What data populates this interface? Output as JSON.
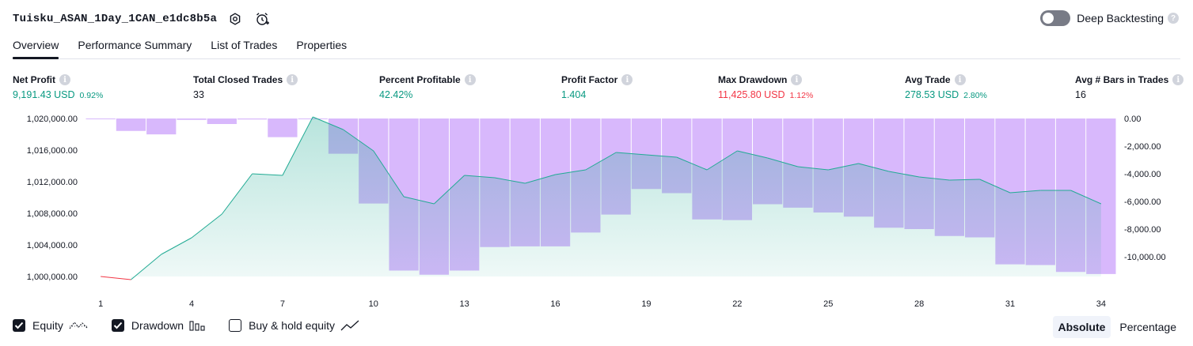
{
  "header": {
    "title": "Tuisku_ASAN_1Day_1CAN_e1dc8b5a"
  },
  "deep_backtesting": {
    "label": "Deep Backtesting"
  },
  "tabs": [
    {
      "label": "Overview"
    },
    {
      "label": "Performance Summary"
    },
    {
      "label": "List of Trades"
    },
    {
      "label": "Properties"
    }
  ],
  "stats": {
    "net_profit": {
      "label": "Net Profit",
      "value": "9,191.43 USD",
      "sub": "0.92%"
    },
    "total_closed_trades": {
      "label": "Total Closed Trades",
      "value": "33"
    },
    "percent_profitable": {
      "label": "Percent Profitable",
      "value": "42.42%"
    },
    "profit_factor": {
      "label": "Profit Factor",
      "value": "1.404"
    },
    "max_drawdown": {
      "label": "Max Drawdown",
      "value": "11,425.80 USD",
      "sub": "1.12%"
    },
    "avg_trade": {
      "label": "Avg Trade",
      "value": "278.53 USD",
      "sub": "2.80%"
    },
    "avg_bars": {
      "label": "Avg # Bars in Trades",
      "value": "16"
    }
  },
  "colors": {
    "profit": "#089981",
    "loss": "#f23645",
    "equity_line": "#22ab94",
    "drawdown_bar": "#d8b8fc"
  },
  "chart_data": {
    "type": "line",
    "x": [
      1,
      2,
      3,
      4,
      5,
      6,
      7,
      8,
      9,
      10,
      11,
      12,
      13,
      14,
      15,
      16,
      17,
      18,
      19,
      20,
      21,
      22,
      23,
      24,
      25,
      26,
      27,
      28,
      29,
      30,
      31,
      32,
      33,
      34
    ],
    "xticks": [
      "1",
      "4",
      "7",
      "10",
      "13",
      "16",
      "19",
      "22",
      "25",
      "28",
      "31",
      "34"
    ],
    "yticks_left": [
      "1,020,000.00",
      "1,016,000.00",
      "1,012,000.00",
      "1,008,000.00",
      "1,004,000.00",
      "1,000,000.00"
    ],
    "yticks_right": [
      "0.00",
      "-2,000.00",
      "-4,000.00",
      "-6,000.00",
      "-8,000.00",
      "-10,000.00"
    ],
    "ylim_left": [
      999000,
      1020000
    ],
    "ylim_right": [
      -12000,
      0
    ],
    "series": [
      {
        "name": "Equity",
        "axis": "left",
        "values": [
          1000000,
          999600,
          1002800,
          1004900,
          1007900,
          1013000,
          1012800,
          1020200,
          1018600,
          1015900,
          1010100,
          1009200,
          1012800,
          1012500,
          1011800,
          1012900,
          1013500,
          1015700,
          1015400,
          1015100,
          1013500,
          1015900,
          1015000,
          1013900,
          1013500,
          1014300,
          1013300,
          1012600,
          1012200,
          1012300,
          1010600,
          1010900,
          1010900,
          1009200
        ]
      },
      {
        "name": "Drawdown",
        "axis": "right",
        "values": [
          -50,
          -900,
          -1150,
          -100,
          -400,
          -70,
          -1350,
          0,
          -2550,
          -6150,
          -11000,
          -11300,
          -11000,
          -9300,
          -9250,
          -9250,
          -8250,
          -6950,
          -5100,
          -5400,
          -7300,
          -7350,
          -6200,
          -6450,
          -6800,
          -7100,
          -7900,
          -8000,
          -8500,
          -8600,
          -10550,
          -10600,
          -11100,
          -11250
        ]
      }
    ]
  },
  "legend": [
    {
      "label": "Equity",
      "checked": true
    },
    {
      "label": "Drawdown",
      "checked": true
    },
    {
      "label": "Buy & hold equity",
      "checked": false
    }
  ],
  "modes": [
    {
      "label": "Absolute",
      "active": true
    },
    {
      "label": "Percentage",
      "active": false
    }
  ]
}
